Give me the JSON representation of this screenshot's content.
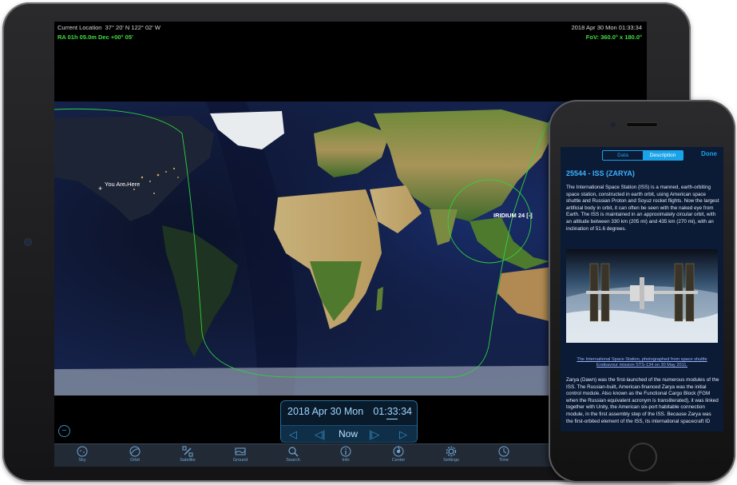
{
  "ipad": {
    "header": {
      "location_label": "Current Location",
      "location_value": "37° 20' N 122° 02' W",
      "datetime": "2018 Apr 30 Mon 01:33:34",
      "ra_dec": "RA 01h 05.0m Dec +00° 05'",
      "fov": "FoV: 360.0° x 180.0°"
    },
    "map": {
      "you_are_here": "You Are Here",
      "satellite_label": "IRIDIUM 24 [-]"
    },
    "time_panel": {
      "date": "2018 Apr 30 Mon",
      "time": "01:33:34",
      "now_label": "Now"
    },
    "tabs": [
      {
        "label": "Sky",
        "icon": "sky-icon"
      },
      {
        "label": "Orbit",
        "icon": "orbit-icon"
      },
      {
        "label": "Satellite",
        "icon": "satellite-icon"
      },
      {
        "label": "Ground",
        "icon": "ground-icon"
      },
      {
        "label": "Search",
        "icon": "search-icon"
      },
      {
        "label": "Info",
        "icon": "info-icon"
      },
      {
        "label": "Center",
        "icon": "center-icon"
      },
      {
        "label": "Settings",
        "icon": "gear-icon"
      },
      {
        "label": "Time",
        "icon": "clock-icon"
      }
    ],
    "colors": {
      "accent": "#3a8cc4",
      "header_green": "#3fe03f",
      "orbit_green": "#2fd13f"
    }
  },
  "iphone": {
    "segments": {
      "data": "Data",
      "description": "Description",
      "selected": "Description"
    },
    "done": "Done",
    "title": "25544 - ISS (ZARYA)",
    "paragraph1": "The International Space Station (ISS) is a manned, earth-orbiting space station, constructed in earth orbit, using American space shuttle and Russian Proton and Soyuz rocket flights. Now the largest artificial body in orbit, it can often be seen with the naked eye from Earth. The ISS is maintained in an approximately circular orbit, with an altitude between 330 km (205 mi) and 435 km (270 mi), with an inclination of 51.6 degrees.",
    "caption": "The International Space Station, photographed from space shuttle Endeavour mission STS-134 on 30 May 2011.",
    "paragraph2": "Zarya (Dawn) was the first-launched of the numerous modules of the ISS. The Russian-built, American-financed Zarya was the initial control module. Also known as the Functional Cargo Block (FGM when the Russian equivalent acronym is transliterated), it was linked together with Unity, the American six-port habitable connection module, in the first assembly step of the ISS. Because Zarya was the first-orbited element of the ISS, its international spacecraft ID",
    "colors": {
      "accent": "#1aa3e8",
      "title": "#3db2ff",
      "background": "#0b1a35"
    }
  }
}
